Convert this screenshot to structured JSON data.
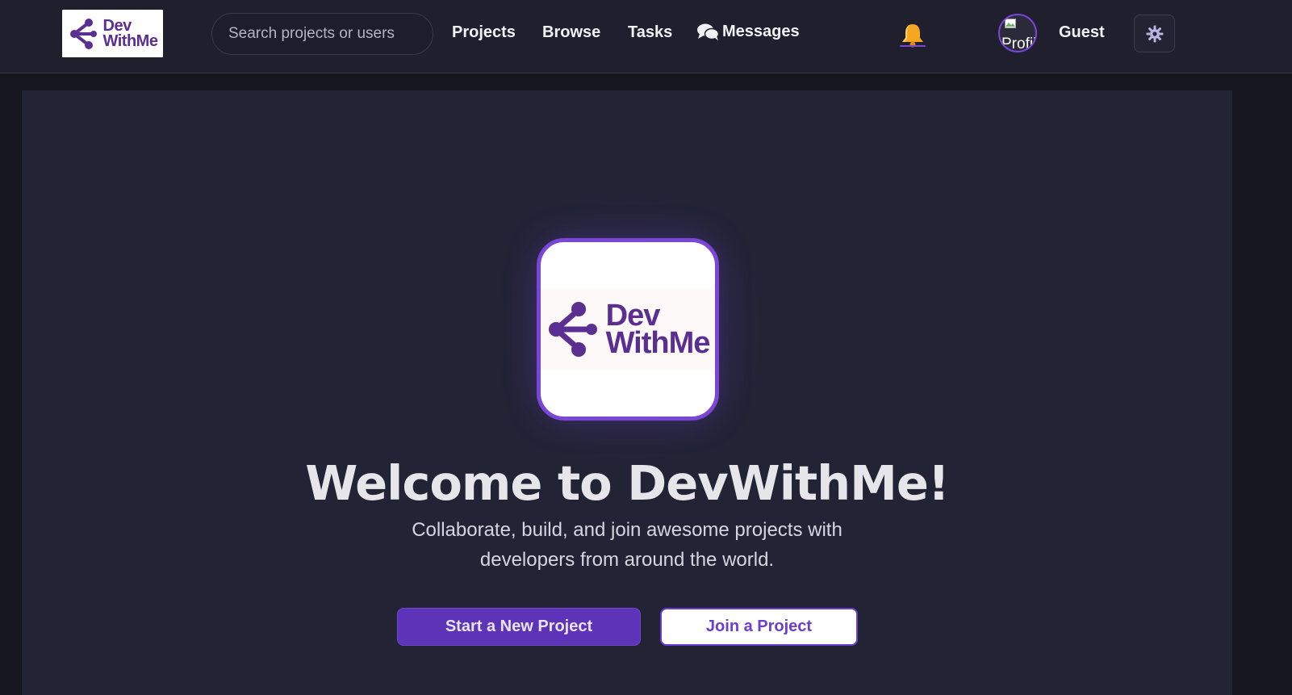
{
  "brand": {
    "line1": "Dev",
    "line2": "WithMe",
    "color": "#5b2e91"
  },
  "search": {
    "placeholder": "Search projects or users"
  },
  "nav": {
    "projects": "Projects",
    "browse": "Browse",
    "tasks": "Tasks",
    "messages": "Messages",
    "messages_icon": "chat-bubbles-icon",
    "notifications_icon": "bell-icon"
  },
  "user": {
    "avatar_alt": "Profil",
    "name": "Guest"
  },
  "theme_toggle": {
    "icon": "gear-icon"
  },
  "hero": {
    "title": "Welcome to DevWithMe!",
    "subtitle_line1": "Collaborate, build, and join awesome projects with",
    "subtitle_line2": "developers from around the world.",
    "primary_button": "Start a New Project",
    "secondary_button": "Join a Project"
  },
  "colors": {
    "accent": "#7b45d8",
    "primary_button": "#5d33b8",
    "background": "#232336",
    "navbar": "#1f1f2e"
  }
}
